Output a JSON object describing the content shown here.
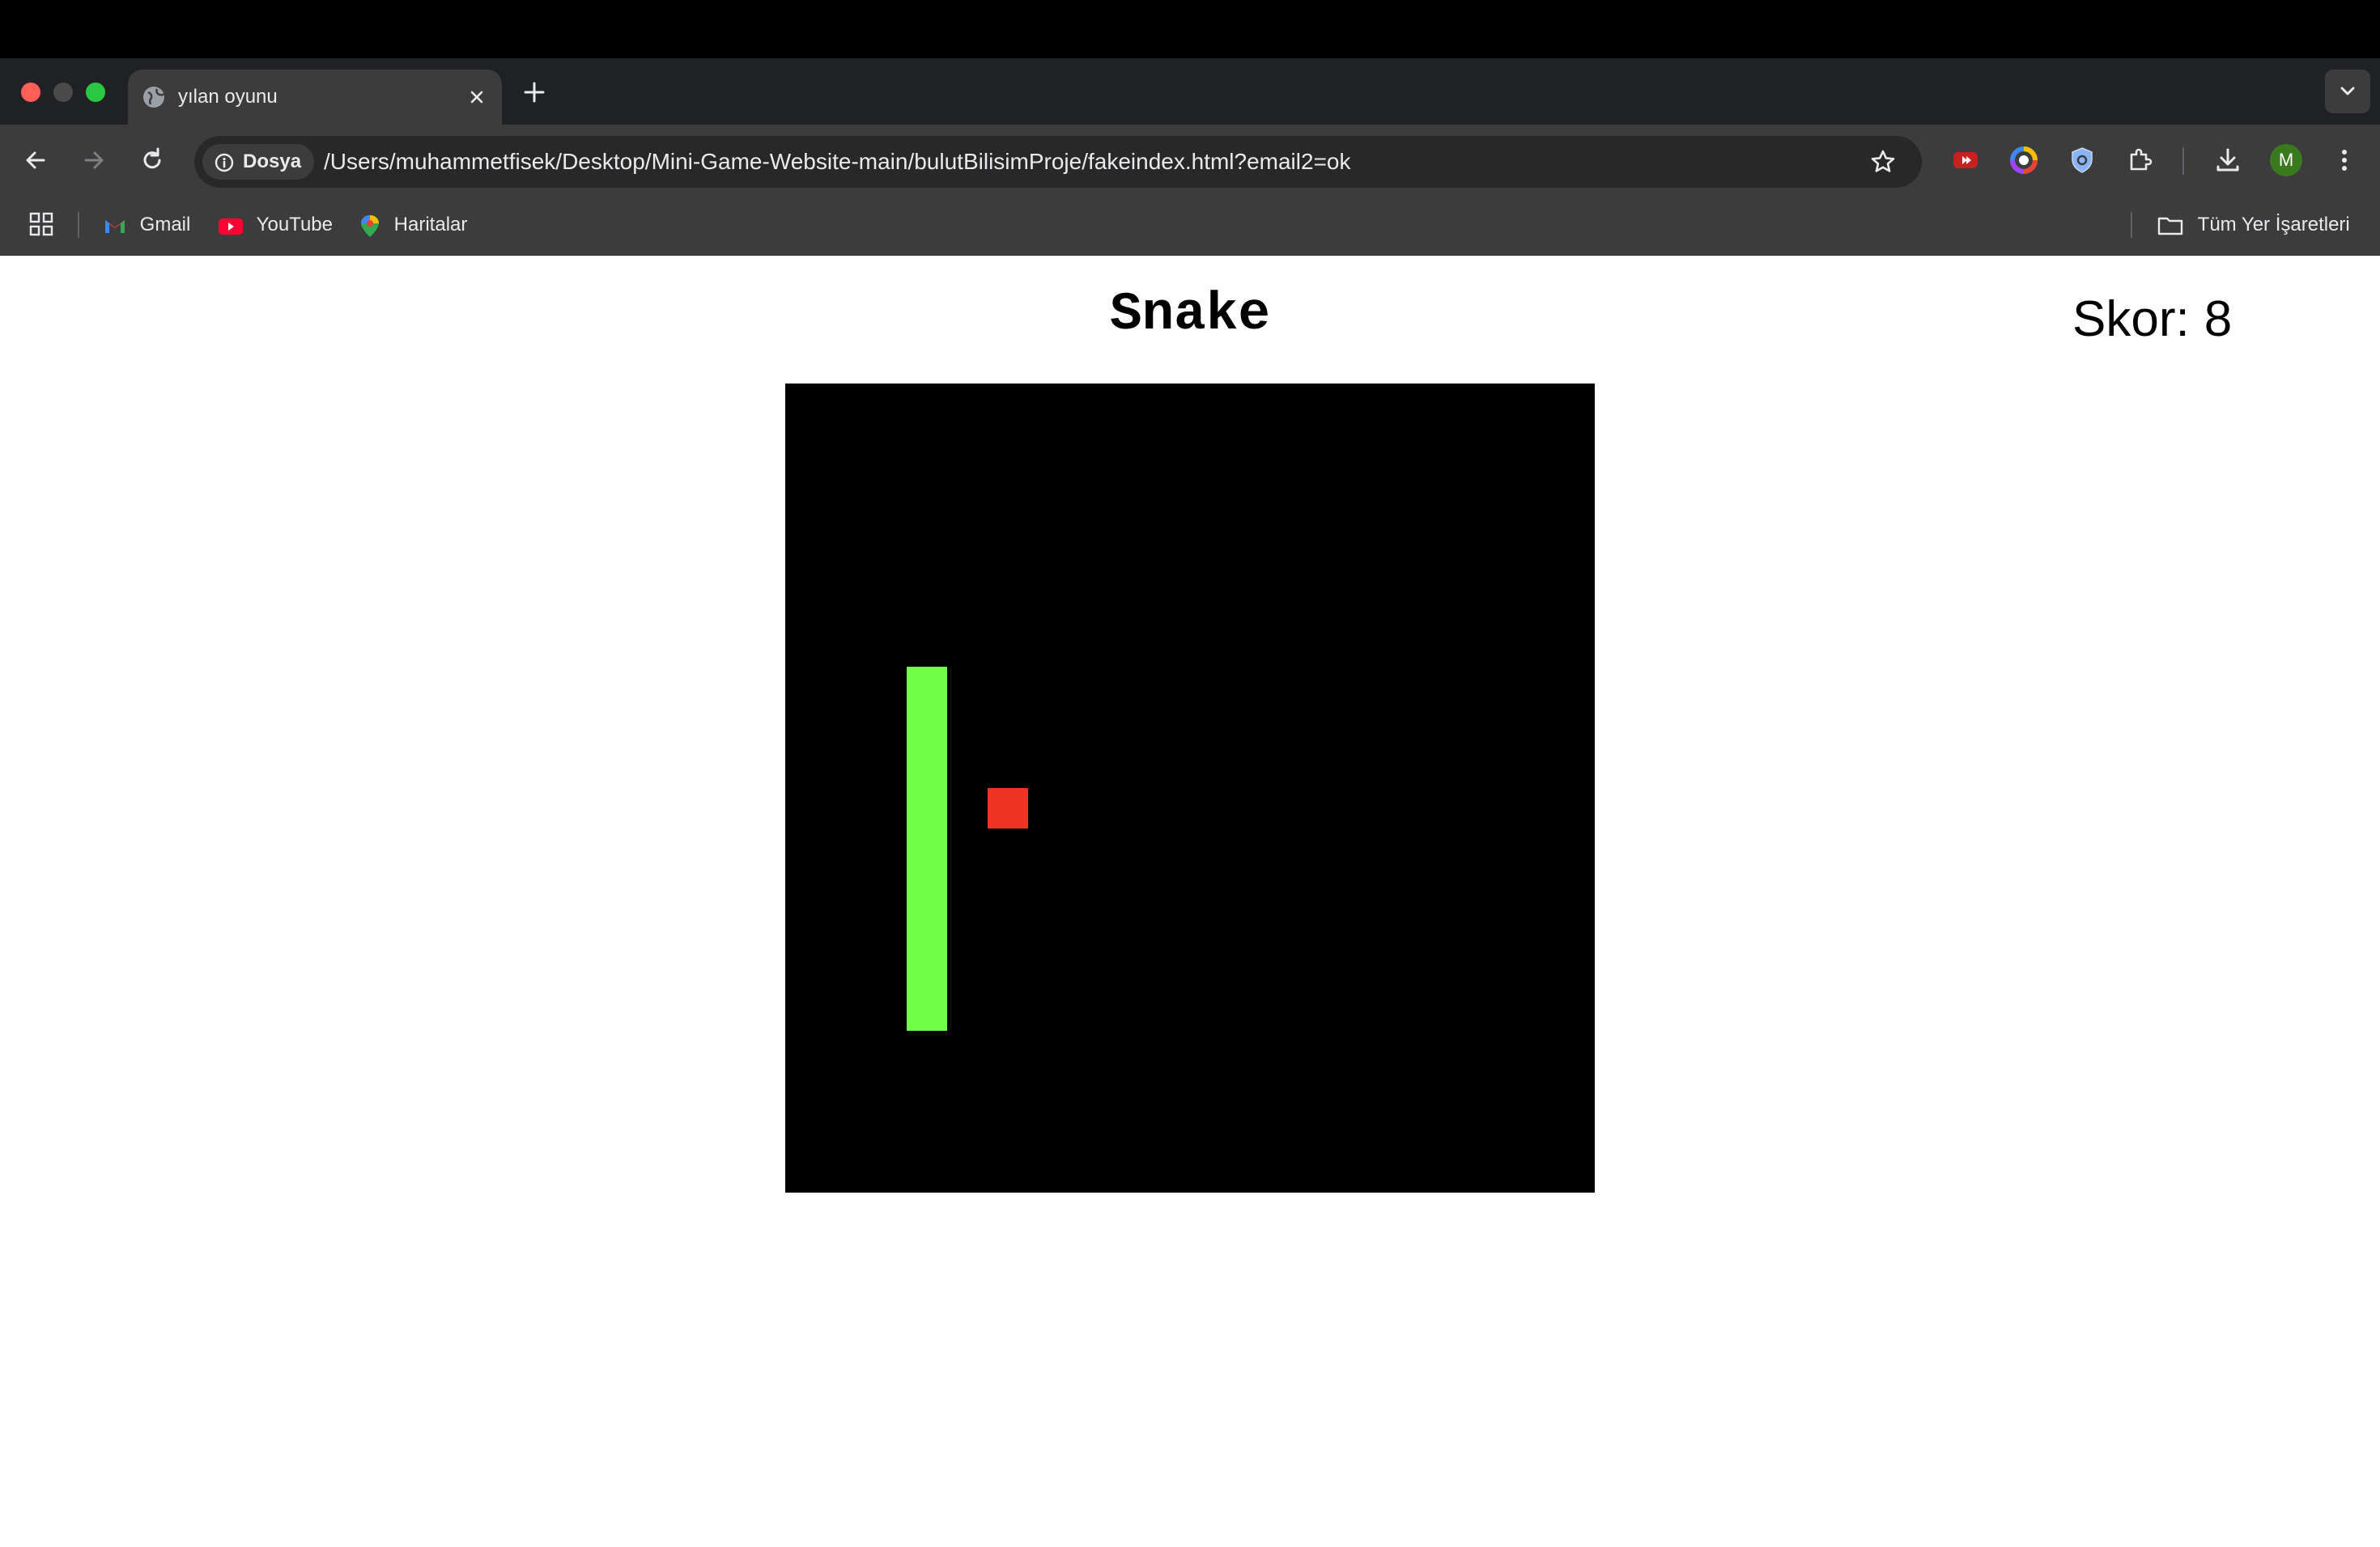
{
  "browser": {
    "tab": {
      "title": "yılan oyunu"
    },
    "address_bar": {
      "site_chip_label": "Dosya",
      "url": "/Users/muhammetfisek/Desktop/Mini-Game-Website-main/bulutBilisimProje/fakeindex.html?email2=ok"
    },
    "profile_initial": "M",
    "bookmarks": {
      "items": [
        {
          "label": "Gmail",
          "icon": "gmail-icon"
        },
        {
          "label": "YouTube",
          "icon": "youtube-icon"
        },
        {
          "label": "Haritalar",
          "icon": "maps-pin-icon"
        }
      ],
      "all_bookmarks_label": "Tüm Yer İşaretleri"
    },
    "colors": {
      "tab_bar": "#202124",
      "toolbar": "#3c3c3c",
      "omnibox": "#282828"
    }
  },
  "game": {
    "title": "Snake",
    "score_label": "Skor:",
    "score_value": "8",
    "colors": {
      "board": "#000000",
      "snake": "#72ff48",
      "food": "#ee3524"
    }
  }
}
